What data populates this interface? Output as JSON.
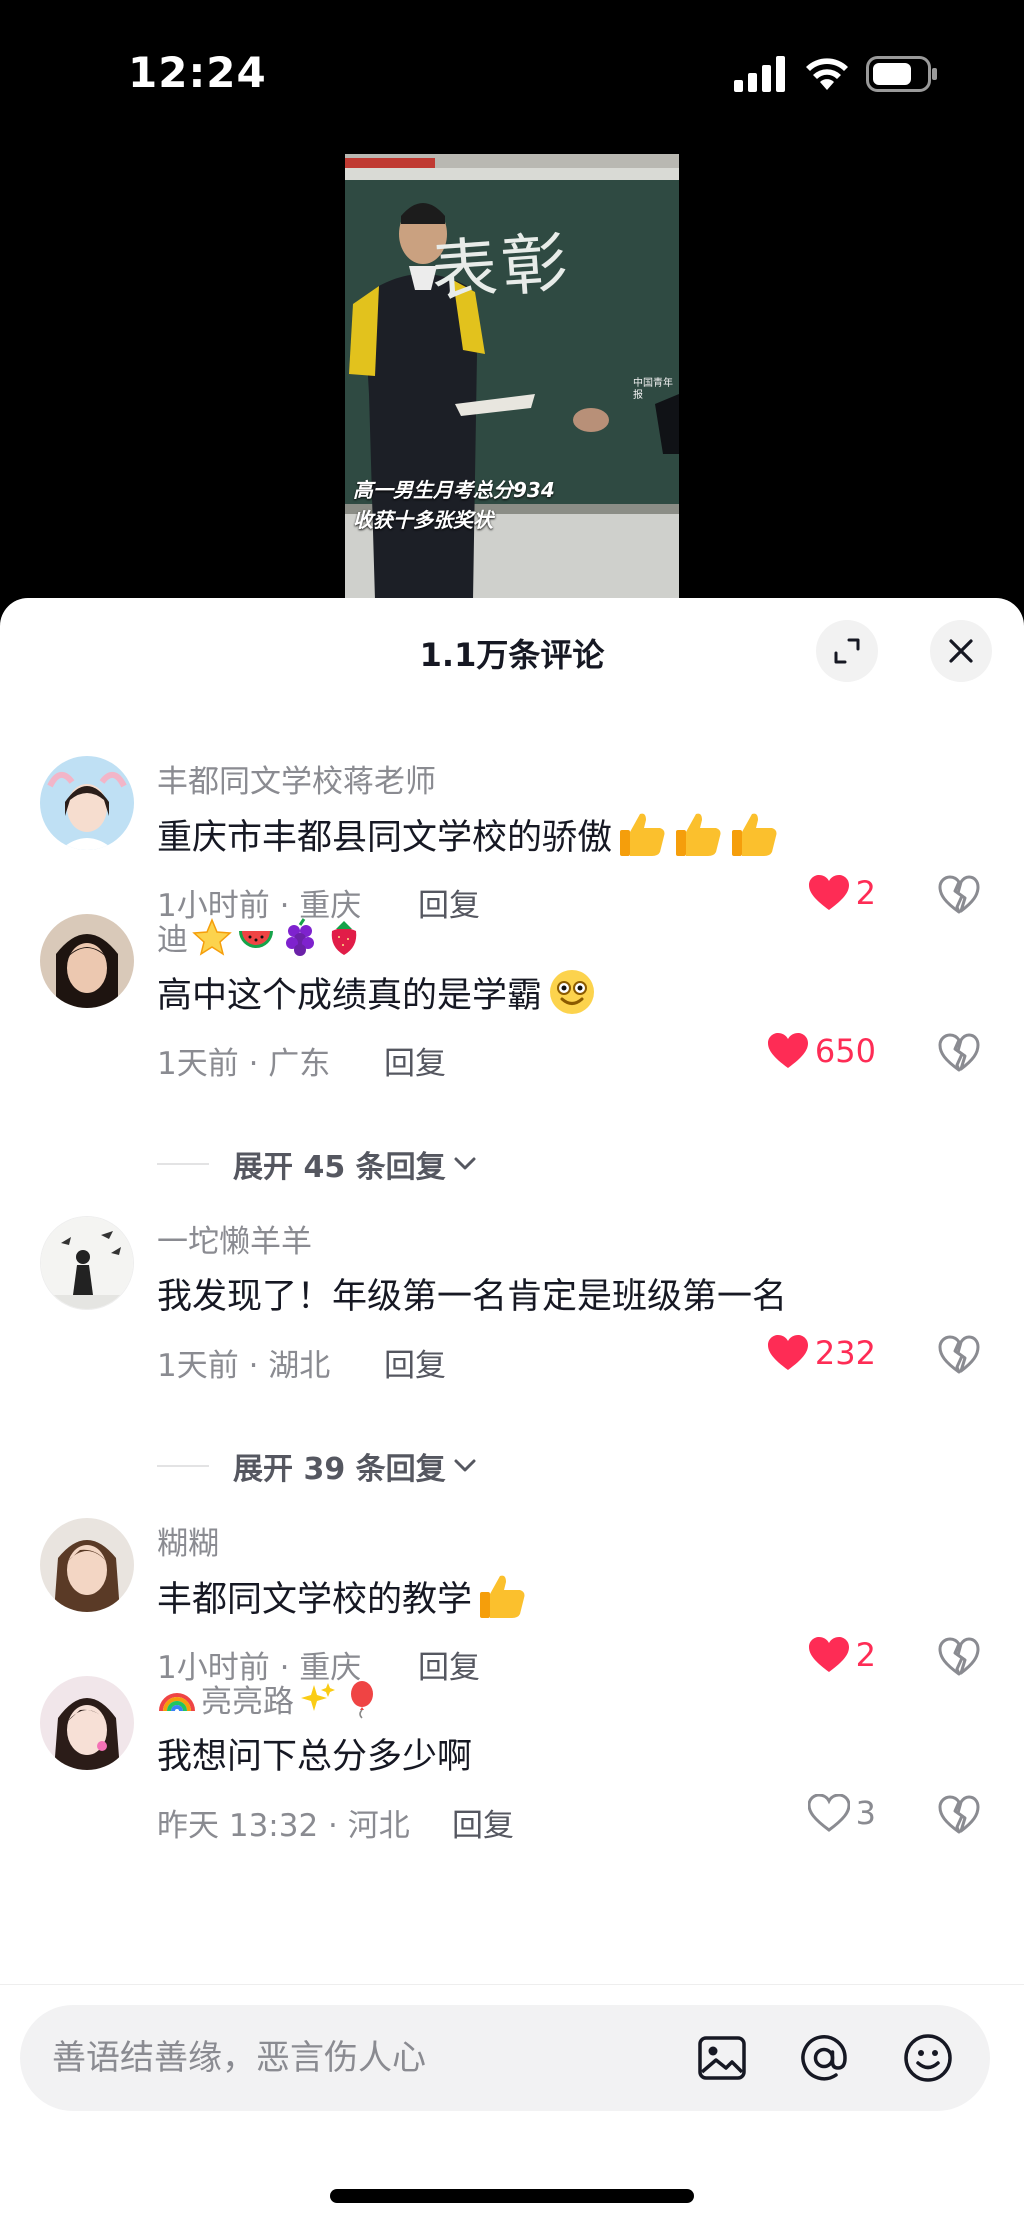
{
  "status_bar": {
    "time": "12:24"
  },
  "video": {
    "board_text": "表彰",
    "watermark": "中国青年报",
    "caption_line1": "高一男生月考总分934",
    "caption_line2": "收获十多张奖状"
  },
  "sheet": {
    "title": "1.1万条评论"
  },
  "comments": [
    {
      "username": "丰都同文学校蒋老师",
      "username_emoji": [],
      "text": "重庆市丰都县同文学校的骄傲",
      "text_emoji": [
        "thumbs-up",
        "thumbs-up",
        "thumbs-up"
      ],
      "meta": "1小时前 · 重庆",
      "reply_label": "回复",
      "likes": "2",
      "liked": true
    },
    {
      "username": "迪",
      "username_emoji": [
        "star",
        "watermelon",
        "grapes",
        "strawberry"
      ],
      "text": "高中这个成绩真的是学霸",
      "text_emoji": [
        "smile-face"
      ],
      "meta": "1天前 · 广东",
      "reply_label": "回复",
      "likes": "650",
      "liked": true,
      "expand_label": "展开 45 条回复"
    },
    {
      "username": "一坨懒羊羊",
      "username_emoji": [],
      "text": "我发现了！年级第一名肯定是班级第一名",
      "text_emoji": [],
      "meta": "1天前 · 湖北",
      "reply_label": "回复",
      "likes": "232",
      "liked": true,
      "expand_label": "展开 39 条回复"
    },
    {
      "username": "糊糊",
      "username_emoji": [],
      "text": "丰都同文学校的教学",
      "text_emoji": [
        "thumbs-up"
      ],
      "meta": "1小时前 · 重庆",
      "reply_label": "回复",
      "likes": "2",
      "liked": true
    },
    {
      "username": "亮亮路",
      "username_emoji": [
        "rainbow",
        "sparkles",
        "balloon"
      ],
      "text": "我想问下总分多少啊",
      "text_emoji": [],
      "meta": "昨天 13:32 · 河北",
      "reply_label": "回复",
      "likes": "3",
      "liked": false
    }
  ],
  "input": {
    "placeholder": "善语结善缘，恶言伤人心"
  },
  "icons": {
    "expand": "expand-icon",
    "close": "close-icon",
    "heart": "heart-icon",
    "dislike": "broken-heart-icon",
    "image": "image-icon",
    "at": "at-icon",
    "emoji": "emoji-icon"
  },
  "colors": {
    "like": "#fe2c55",
    "text": "#161823",
    "secondary": "#8a8b91"
  }
}
